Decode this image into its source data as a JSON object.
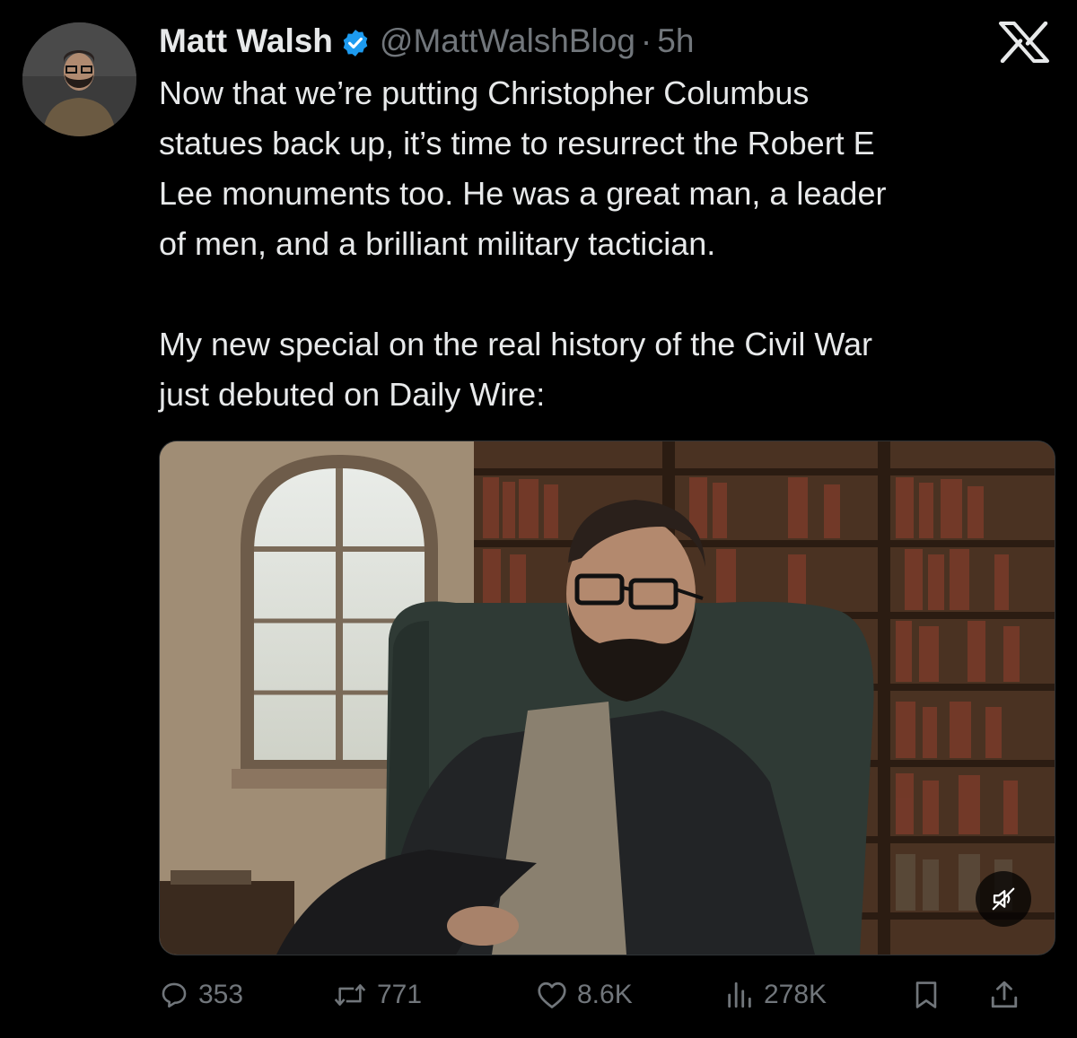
{
  "tweet": {
    "author_name": "Matt Walsh",
    "handle": "@MattWalshBlog",
    "separator": "·",
    "time": "5h",
    "paragraph_1": "Now that we’re putting Christopher Columbus\nstatues back up, it’s time to resurrect the Robert E\nLee monuments too. He was a great man, a leader\nof men, and a brilliant military tactician.",
    "paragraph_2": "My new special on the real history of the Civil War\njust debuted on Daily Wire:"
  },
  "icons": {
    "verified": "verified-badge-icon",
    "brand": "x-logo-icon",
    "mute": "muted-speaker-icon",
    "reply": "reply-bubble-icon",
    "repost": "repost-arrows-icon",
    "like": "heart-icon",
    "views": "bar-chart-icon",
    "bookmark": "bookmark-icon",
    "share": "share-upload-icon"
  },
  "actions": {
    "replies": "353",
    "reposts": "771",
    "likes": "8.6K",
    "views": "278K"
  },
  "colors": {
    "background": "#000000",
    "text": "#e7e9ea",
    "muted": "#71767b",
    "verified": "#1d9bf0"
  }
}
